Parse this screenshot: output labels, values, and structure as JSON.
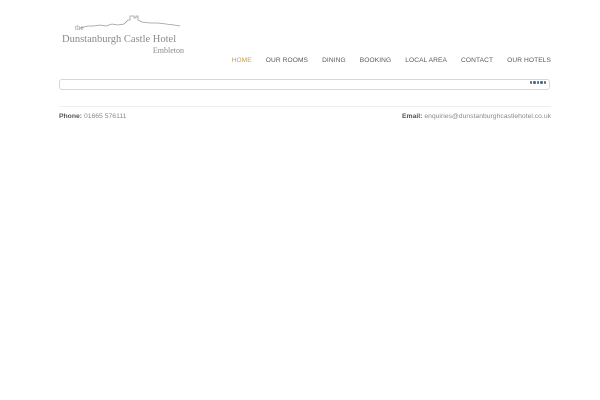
{
  "logo": {
    "the": "the",
    "name": "Dunstanburgh Castle Hotel",
    "place": "Embleton"
  },
  "nav": {
    "items": [
      {
        "label": "HOME",
        "active": true
      },
      {
        "label": "OUR ROOMS",
        "active": false
      },
      {
        "label": "DINING",
        "active": false
      },
      {
        "label": "BOOKING",
        "active": false
      },
      {
        "label": "LOCAL AREA",
        "active": false
      },
      {
        "label": "CONTACT",
        "active": false
      },
      {
        "label": "OUR HOTELS",
        "active": false
      }
    ],
    "active_color": "#c8a050"
  },
  "contact": {
    "phone_label": "Phone:",
    "phone_value": "01665 576111",
    "email_label": "Email:",
    "email_value": "enquiries@dunstanburghcastlehotel.co.uk"
  }
}
